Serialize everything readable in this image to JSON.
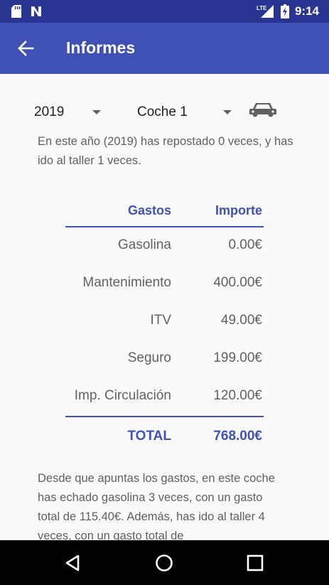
{
  "status_bar": {
    "time": "9:14",
    "network_label": "LTE",
    "icons": [
      "sd-card-icon",
      "notification-n-icon",
      "lte-signal-icon",
      "battery-charging-icon"
    ]
  },
  "app_bar": {
    "title": "Informes",
    "back_icon": "arrow-back-icon",
    "color": "#3f51b5",
    "status_color": "#283593"
  },
  "filters": {
    "year": "2019",
    "car": "Coche 1",
    "car_icon": "car-icon"
  },
  "intro_text": "En este año (2019) has repostado 0 veces, y has ido al taller 1 veces.",
  "table": {
    "header": {
      "concept": "Gastos",
      "amount": "Importe"
    },
    "rows": [
      {
        "concept": "Gasolina",
        "amount": "0.00€"
      },
      {
        "concept": "Mantenimiento",
        "amount": "400.00€"
      },
      {
        "concept": "ITV",
        "amount": "49.00€"
      },
      {
        "concept": "Seguro",
        "amount": "199.00€"
      },
      {
        "concept": "Imp. Circulación",
        "amount": "120.00€"
      }
    ],
    "total": {
      "concept": "TOTAL",
      "amount": "768.00€"
    }
  },
  "summary_text": "Desde que apuntas los gastos, en este coche has echado gasolina 3 veces, con un gasto total de 115.40€. Además, has ido al taller 4 veces, con un gasto total de",
  "nav_bar": {
    "back": "nav-back-icon",
    "home": "nav-home-icon",
    "recents": "nav-recents-icon"
  }
}
